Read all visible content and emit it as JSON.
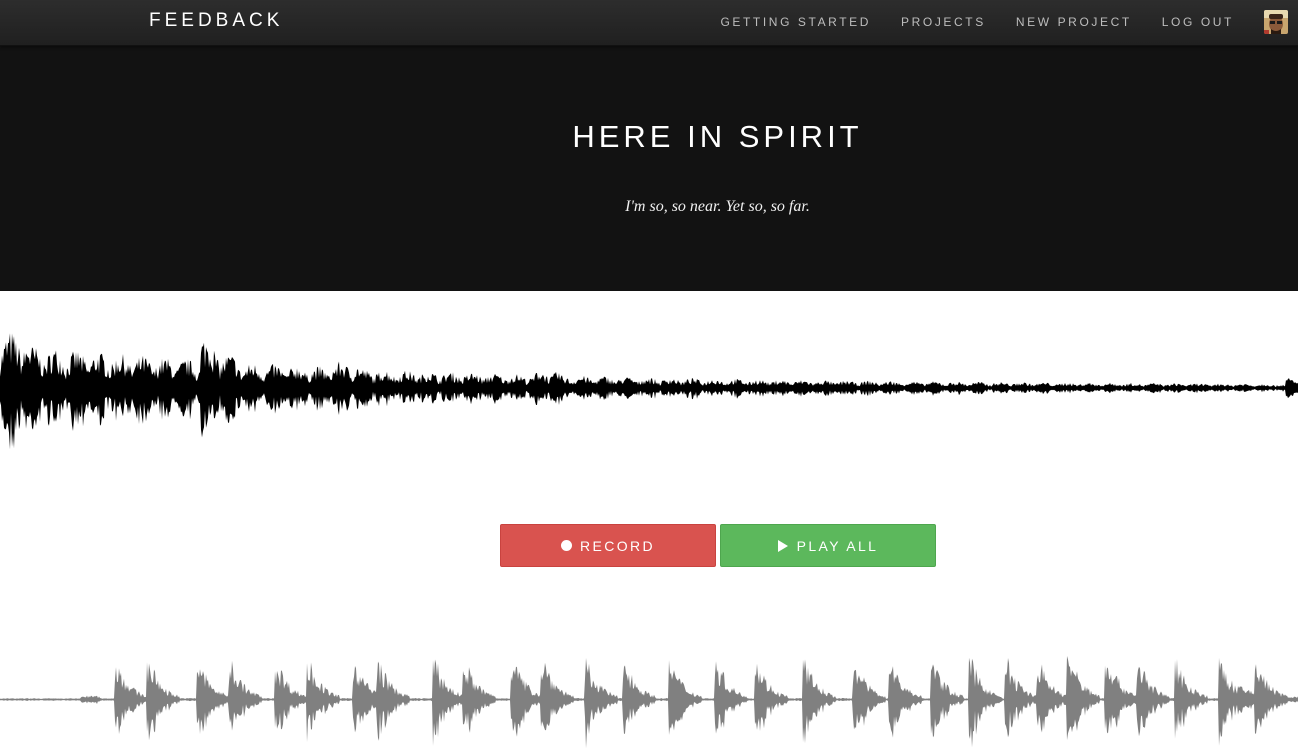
{
  "navbar": {
    "brand": "FEEDBACK",
    "links": [
      {
        "label": "GETTING STARTED"
      },
      {
        "label": "PROJECTS"
      },
      {
        "label": "NEW PROJECT"
      },
      {
        "label": "LOG OUT"
      }
    ],
    "avatar_icon": "user-avatar"
  },
  "project": {
    "title": "HERE IN SPIRIT",
    "subtitle": "I'm so, so near. Yet so, so far."
  },
  "controls": {
    "record_label": "RECORD",
    "record_icon": "record-dot-icon",
    "play_all_label": "PLAY ALL",
    "play_icon": "play-triangle-icon"
  },
  "colors": {
    "record": "#d9534f",
    "play": "#5cb85c",
    "hero_bg": "#121212",
    "track_1_wave": "#000000",
    "track_2_wave": "#808080"
  },
  "tracks": [
    {
      "waveform_color": "#000000"
    },
    {
      "waveform_color": "#808080"
    }
  ]
}
